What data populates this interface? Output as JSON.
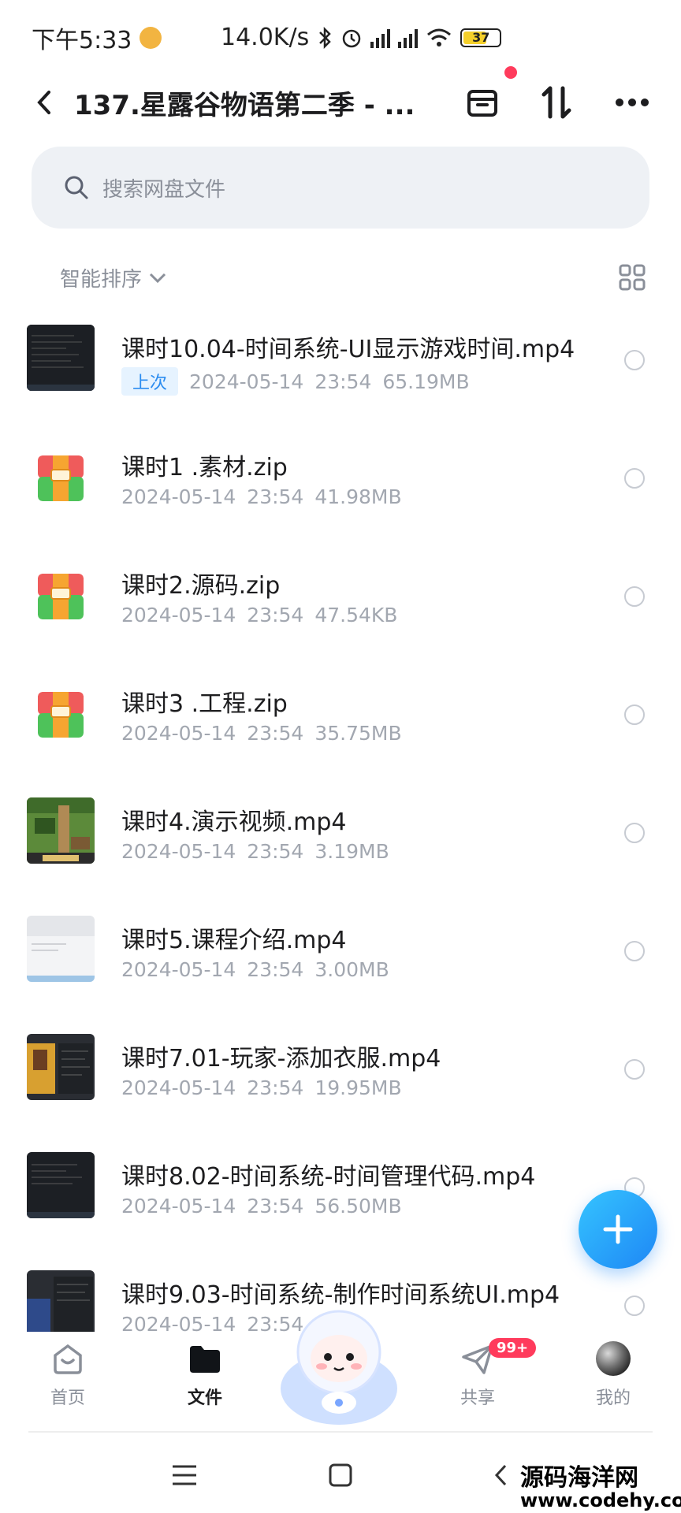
{
  "status_bar": {
    "time": "下午5:33",
    "speed": "14.0K/s",
    "battery": "37"
  },
  "header": {
    "title": "137.星露谷物语第二季 - ..."
  },
  "search": {
    "placeholder": "搜索网盘文件"
  },
  "sort": {
    "label": "智能排序"
  },
  "files": [
    {
      "name": "课时10.04-时间系统-UI显示游戏时间.mp4",
      "tag": "上次",
      "date": "2024-05-14",
      "time": "23:54",
      "size": "65.19MB",
      "icon": "video-thumbnail"
    },
    {
      "name": "课时1 .素材.zip",
      "date": "2024-05-14",
      "time": "23:54",
      "size": "41.98MB",
      "icon": "zip-icon"
    },
    {
      "name": "课时2.源码.zip",
      "date": "2024-05-14",
      "time": "23:54",
      "size": "47.54KB",
      "icon": "zip-icon"
    },
    {
      "name": "课时3 .工程.zip",
      "date": "2024-05-14",
      "time": "23:54",
      "size": "35.75MB",
      "icon": "zip-icon"
    },
    {
      "name": "课时4.演示视频.mp4",
      "date": "2024-05-14",
      "time": "23:54",
      "size": "3.19MB",
      "icon": "video-thumbnail"
    },
    {
      "name": "课时5.课程介绍.mp4",
      "date": "2024-05-14",
      "time": "23:54",
      "size": "3.00MB",
      "icon": "video-thumbnail"
    },
    {
      "name": "课时7.01-玩家-添加衣服.mp4",
      "date": "2024-05-14",
      "time": "23:54",
      "size": "19.95MB",
      "icon": "video-thumbnail"
    },
    {
      "name": "课时8.02-时间系统-时间管理代码.mp4",
      "date": "2024-05-14",
      "time": "23:54",
      "size": "56.50MB",
      "icon": "video-thumbnail"
    },
    {
      "name": "课时9.03-时间系统-制作时间系统UI.mp4",
      "date": "2024-05-14",
      "time": "23:54",
      "size": "",
      "icon": "video-thumbnail"
    }
  ],
  "tabs": [
    {
      "label": "首页",
      "icon": "home-icon"
    },
    {
      "label": "文件",
      "icon": "folder-icon"
    },
    {
      "label": "共享",
      "icon": "share-icon"
    },
    {
      "label": "我的",
      "icon": "avatar-icon"
    }
  ],
  "share_badge": "99+",
  "watermark": {
    "line1": "源码海洋网",
    "line2": "www.codehy.com"
  },
  "colors": {
    "accent": "#2b8cf0",
    "fab_start": "#35c4ff",
    "fab_end": "#1e87f5",
    "badge": "#ff3b5c"
  }
}
